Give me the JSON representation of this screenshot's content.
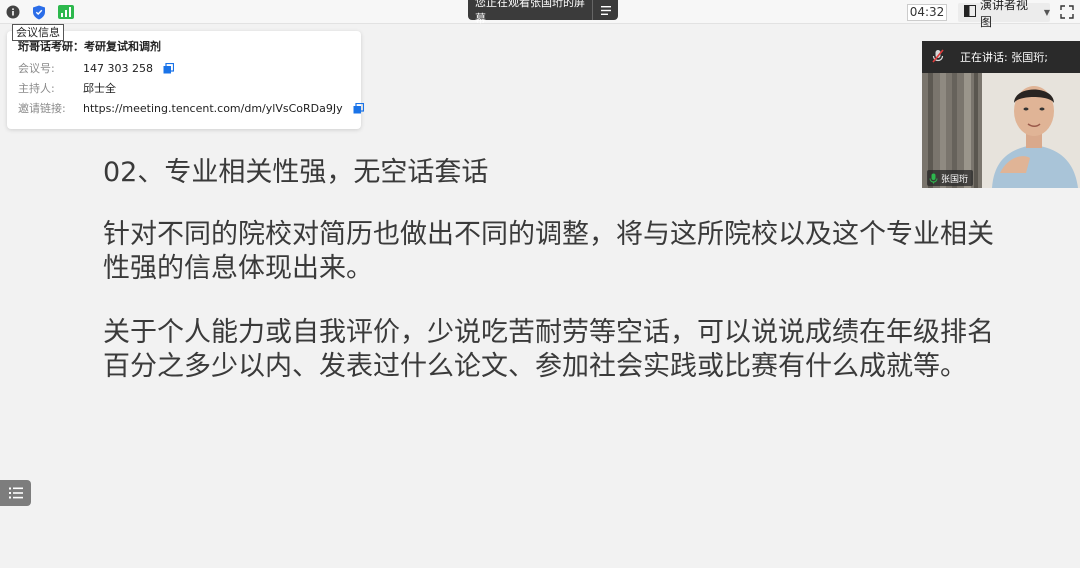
{
  "toolbar": {
    "tooltip": "会议信息",
    "share_banner": "您正在观看张国珩的屏幕",
    "timer": "04:32",
    "view_mode": "演讲者视图"
  },
  "meeting_info": {
    "title": "珩哥话考研：考研复试和调剂",
    "rows": [
      {
        "label": "会议号:",
        "value": "147 303 258"
      },
      {
        "label": "主持人:",
        "value": "邱士全"
      },
      {
        "label": "邀请链接:",
        "value": "https://meeting.tencent.com/dm/ylVsCoRDa9Jy"
      }
    ]
  },
  "slide": {
    "heading": "02、专业相关性强，无空话套话",
    "paragraph_1": "针对不同的院校对简历也做出不同的调整，将与这所院校以及这个专业相关性强的信息体现出来。",
    "paragraph_2": "关于个人能力或自我评价，少说吃苦耐劳等空话，可以说说成绩在年级排名百分之多少以内、发表过什么论文、参加社会实践或比赛有什么成就等。"
  },
  "video": {
    "speaking_label": "正在讲话: 张国珩;",
    "participant_name": "张国珩"
  },
  "colors": {
    "accent": "#1a73e8",
    "signal": "#2db84d",
    "shield": "#2b6de8"
  }
}
